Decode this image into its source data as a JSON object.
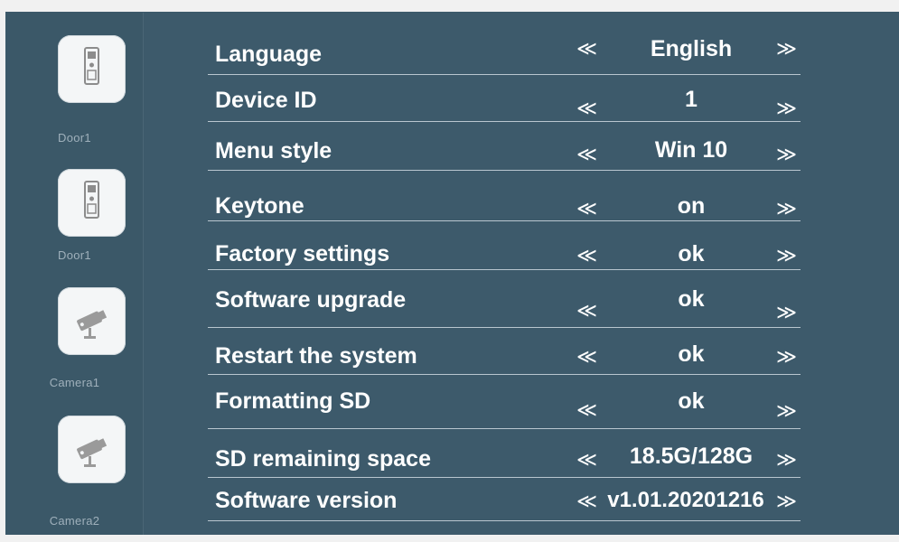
{
  "sidebar": {
    "items": [
      {
        "label": "Door1",
        "icon": "door-phone-icon"
      },
      {
        "label": "Door1",
        "icon": "door-phone-icon"
      },
      {
        "label": "Camera1",
        "icon": "camera-icon"
      },
      {
        "label": "Camera2",
        "icon": "camera-icon"
      }
    ]
  },
  "settings": {
    "prev_symbol": "≪",
    "next_symbol": "≫",
    "rows": [
      {
        "label": "Language",
        "value": "English"
      },
      {
        "label": "Device ID",
        "value": "1"
      },
      {
        "label": "Menu style",
        "value": "Win 10"
      },
      {
        "label": "Keytone",
        "value": "on"
      },
      {
        "label": "Factory settings",
        "value": "ok"
      },
      {
        "label": "Software upgrade",
        "value": "ok"
      },
      {
        "label": "Restart the system",
        "value": "ok"
      },
      {
        "label": "Formatting SD",
        "value": "ok"
      },
      {
        "label": "SD remaining space",
        "value": "18.5G/128G"
      },
      {
        "label": "Software version",
        "value": "v1.01.20201216"
      }
    ]
  },
  "colors": {
    "panel_background": "#3d5a6b",
    "sidebar_background": "#3b5868",
    "text": "#ffffff",
    "divider": "#b9c6cf"
  }
}
